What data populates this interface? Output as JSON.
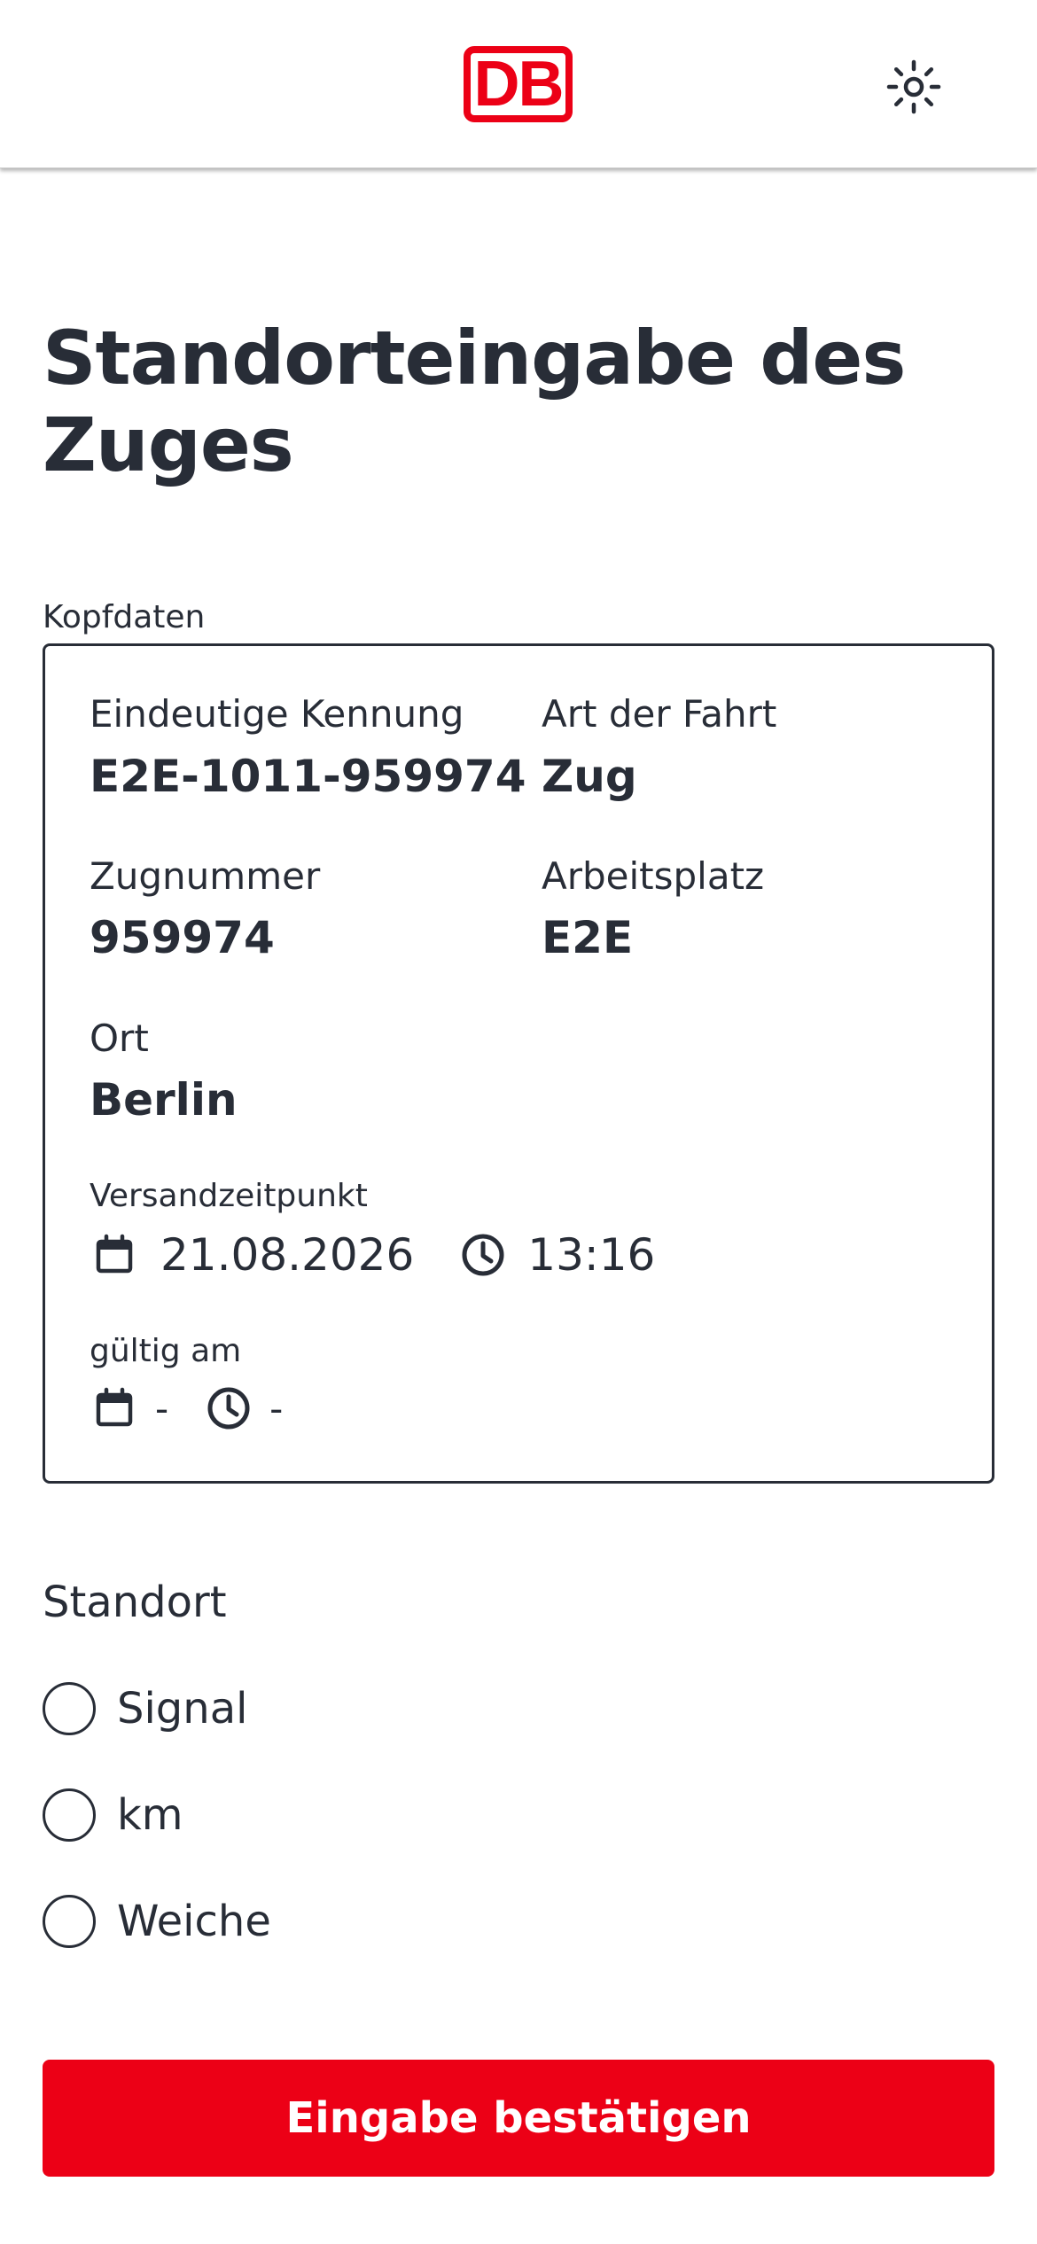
{
  "header": {
    "logo_text": "DB",
    "theme_icon": "sun-icon",
    "brand_color": "#ec0016"
  },
  "page": {
    "title": "Standorteingabe des Zuges"
  },
  "kopfdaten": {
    "section_label": "Kopfdaten",
    "eindeutige_kennung": {
      "label": "Eindeutige Kennung",
      "value": "E2E-1011-959974"
    },
    "art_der_fahrt": {
      "label": "Art der Fahrt",
      "value": "Zug"
    },
    "zugnummer": {
      "label": "Zugnummer",
      "value": "959974"
    },
    "arbeitsplatz": {
      "label": "Arbeitsplatz",
      "value": "E2E"
    },
    "ort": {
      "label": "Ort",
      "value": "Berlin"
    },
    "versandzeitpunkt": {
      "label": "Versandzeitpunkt",
      "date": "21.08.2026",
      "time": "13:16",
      "date_icon": "calendar-icon",
      "time_icon": "clock-icon"
    },
    "gueltig_am": {
      "label": "gültig am",
      "date": "-",
      "time": "-",
      "date_icon": "calendar-icon",
      "time_icon": "clock-icon"
    }
  },
  "standort": {
    "label": "Standort",
    "options": [
      {
        "label": "Signal",
        "selected": false
      },
      {
        "label": "km",
        "selected": false
      },
      {
        "label": "Weiche",
        "selected": false
      }
    ]
  },
  "actions": {
    "submit_label": "Eingabe bestätigen"
  },
  "colors": {
    "text": "#282d37",
    "primary_button": "#ec0016",
    "background": "#ffffff"
  }
}
